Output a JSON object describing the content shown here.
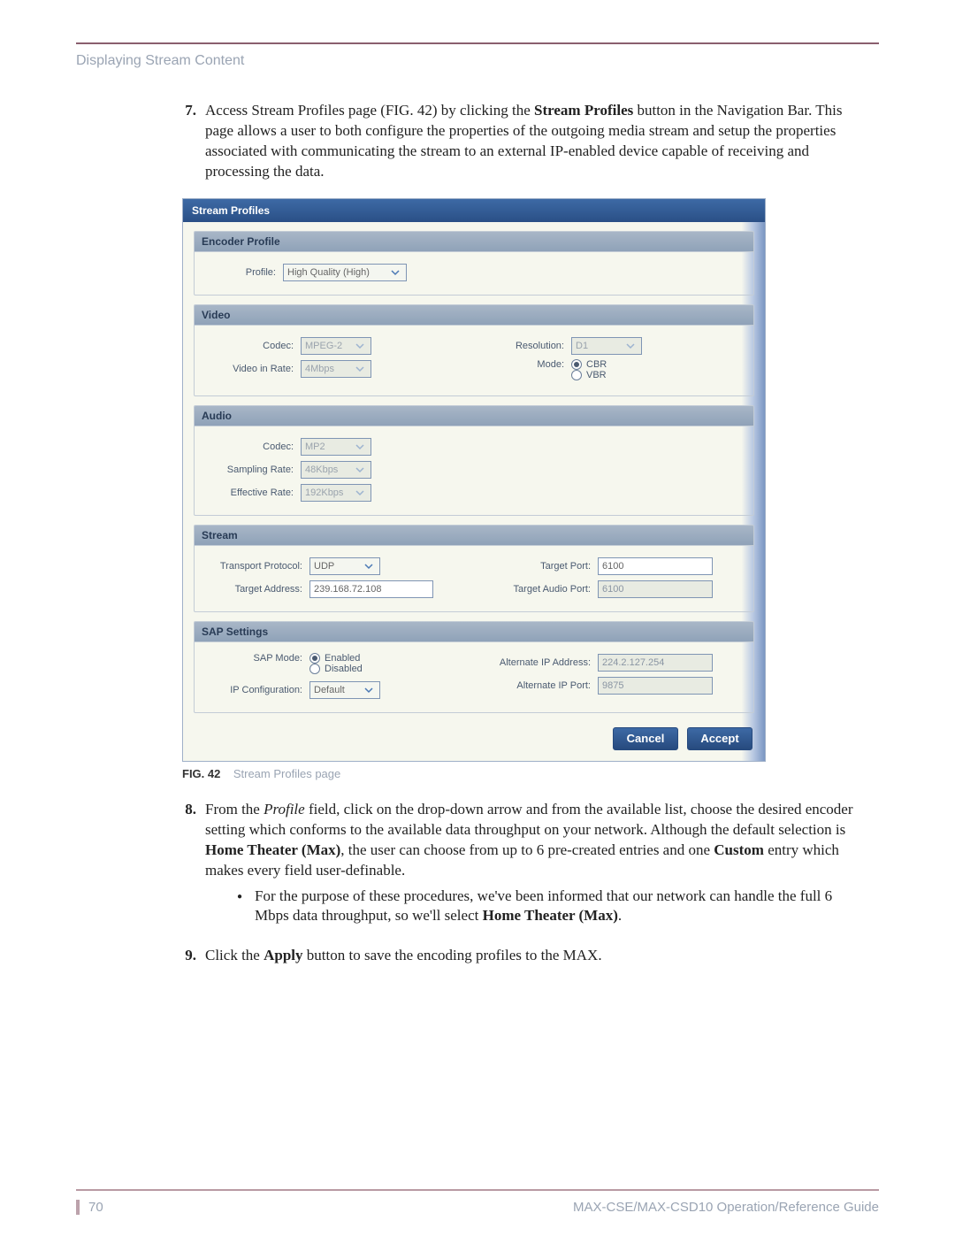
{
  "header": {
    "section_title": "Displaying Stream Content"
  },
  "steps": {
    "s7": {
      "num": "7.",
      "pre": "Access Stream Profiles page (FIG. 42) by clicking the ",
      "b1": "Stream Profiles",
      "post": " button in the Navigation Bar. This page allows a user to both configure the properties of the outgoing media stream and setup the properties associated with communicating the stream to an external IP-enabled device capable of receiving and processing the data."
    },
    "s8": {
      "num": "8.",
      "pre": "From the ",
      "i1": "Profile",
      "mid1": " field, click on the drop-down arrow and from the available list, choose the desired encoder setting which conforms to the available data throughput on your network. Although the default selection is ",
      "b1": "Home Theater (Max)",
      "mid2": ", the user can choose from up to 6 pre-created entries and one ",
      "b2": "Custom",
      "post": " entry which makes every field user-definable.",
      "bullet": {
        "pre": "For the purpose of these procedures, we've been informed that our network can handle the full 6 Mbps data throughput, so we'll select ",
        "b1": "Home Theater (Max)",
        "post": "."
      }
    },
    "s9": {
      "num": "9.",
      "pre": "Click the ",
      "b1": "Apply",
      "post": " button to save the encoding profiles to the MAX."
    }
  },
  "figure": {
    "label": "FIG. 42",
    "caption": "Stream Profiles page",
    "panel_title": "Stream Profiles",
    "sections": {
      "encoder": {
        "title": "Encoder Profile",
        "profile_label": "Profile:",
        "profile_value": "High Quality (High)"
      },
      "video": {
        "title": "Video",
        "codec_label": "Codec:",
        "codec_value": "MPEG-2",
        "rate_label": "Video in Rate:",
        "rate_value": "4Mbps",
        "res_label": "Resolution:",
        "res_value": "D1",
        "mode_label": "Mode:",
        "mode_cbr": "CBR",
        "mode_vbr": "VBR"
      },
      "audio": {
        "title": "Audio",
        "codec_label": "Codec:",
        "codec_value": "MP2",
        "samp_label": "Sampling Rate:",
        "samp_value": "48Kbps",
        "eff_label": "Effective Rate:",
        "eff_value": "192Kbps"
      },
      "stream": {
        "title": "Stream",
        "proto_label": "Transport Protocol:",
        "proto_value": "UDP",
        "addr_label": "Target Address:",
        "addr_value": "239.168.72.108",
        "tport_label": "Target Port:",
        "tport_value": "6100",
        "aport_label": "Target Audio Port:",
        "aport_value": "6100"
      },
      "sap": {
        "title": "SAP Settings",
        "mode_label": "SAP Mode:",
        "enabled": "Enabled",
        "disabled": "Disabled",
        "ipcfg_label": "IP Configuration:",
        "ipcfg_value": "Default",
        "altip_label": "Alternate IP Address:",
        "altip_value": "224.2.127.254",
        "altport_label": "Alternate IP Port:",
        "altport_value": "9875"
      }
    },
    "buttons": {
      "cancel": "Cancel",
      "accept": "Accept"
    }
  },
  "footer": {
    "page_number": "70",
    "guide": "MAX-CSE/MAX-CSD10 Operation/Reference Guide"
  }
}
